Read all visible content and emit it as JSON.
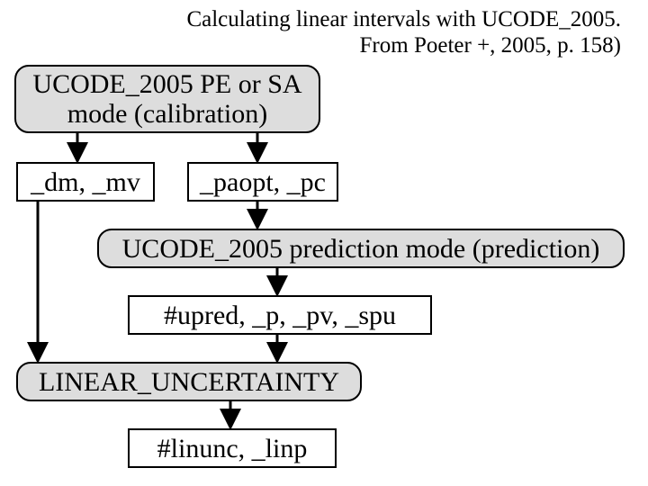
{
  "caption": {
    "line1": "Calculating linear intervals with UCODE_2005.",
    "line2": "From Poeter +, 2005, p. 158)"
  },
  "boxes": {
    "pe_sa": {
      "line1": "UCODE_2005 PE or SA",
      "line2": "mode (calibration)"
    },
    "dm_mv": "_dm, _mv",
    "paopt_pc": "_paopt, _pc",
    "prediction": "UCODE_2005 prediction mode (prediction)",
    "upred": "#upred, _p, _pv, _spu",
    "linear_unc": "LINEAR_UNCERTAINTY",
    "linunc": "#linunc, _linp"
  }
}
